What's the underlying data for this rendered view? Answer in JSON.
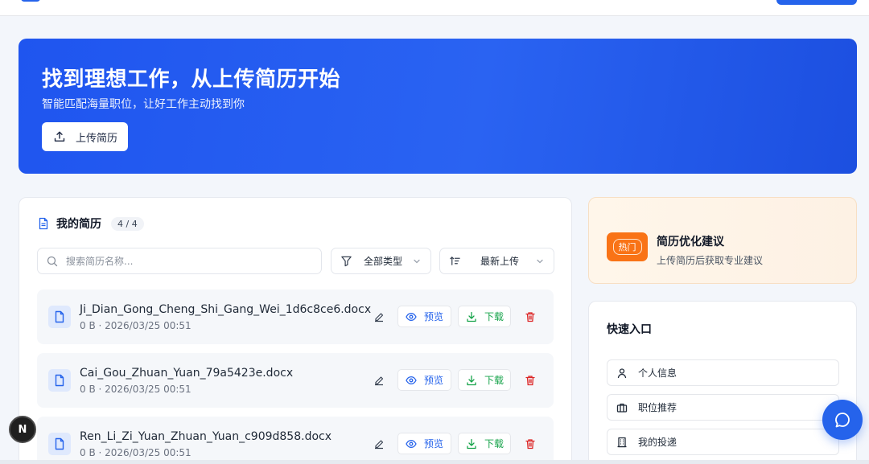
{
  "colors": {
    "primary": "#2563eb",
    "success": "#16a34a",
    "danger": "#dc2626",
    "hot": "#f97316"
  },
  "hero": {
    "title": "找到理想工作，从上传简历开始",
    "subtitle": "智能匹配海量职位，让好工作主动找到你",
    "upload_label": "上传简历"
  },
  "resumes": {
    "title": "我的简历",
    "count": "4 / 4",
    "search_placeholder": "搜索简历名称...",
    "type_filter": "全部类型",
    "sort": "最新上传",
    "preview_label": "预览",
    "download_label": "下载",
    "items": [
      {
        "name": "Ji_Dian_Gong_Cheng_Shi_Gang_Wei_1d6c8ce6.docx",
        "meta": "0 B · 2026/03/25 00:51"
      },
      {
        "name": "Cai_Gou_Zhuan_Yuan_79a5423e.docx",
        "meta": "0 B · 2026/03/25 00:51"
      },
      {
        "name": "Ren_Li_Zi_Yuan_Zhuan_Yuan_c909d858.docx",
        "meta": "0 B · 2026/03/25 00:51"
      }
    ]
  },
  "tips": {
    "badge": "热门",
    "title": "简历优化建议",
    "subtitle": "上传简历后获取专业建议"
  },
  "quick": {
    "title": "快速入口",
    "items": [
      {
        "label": "个人信息",
        "icon": "user-icon"
      },
      {
        "label": "职位推荐",
        "icon": "briefcase-icon"
      },
      {
        "label": "我的投递",
        "icon": "building-icon"
      }
    ]
  },
  "floating": {
    "n_badge": "N"
  }
}
